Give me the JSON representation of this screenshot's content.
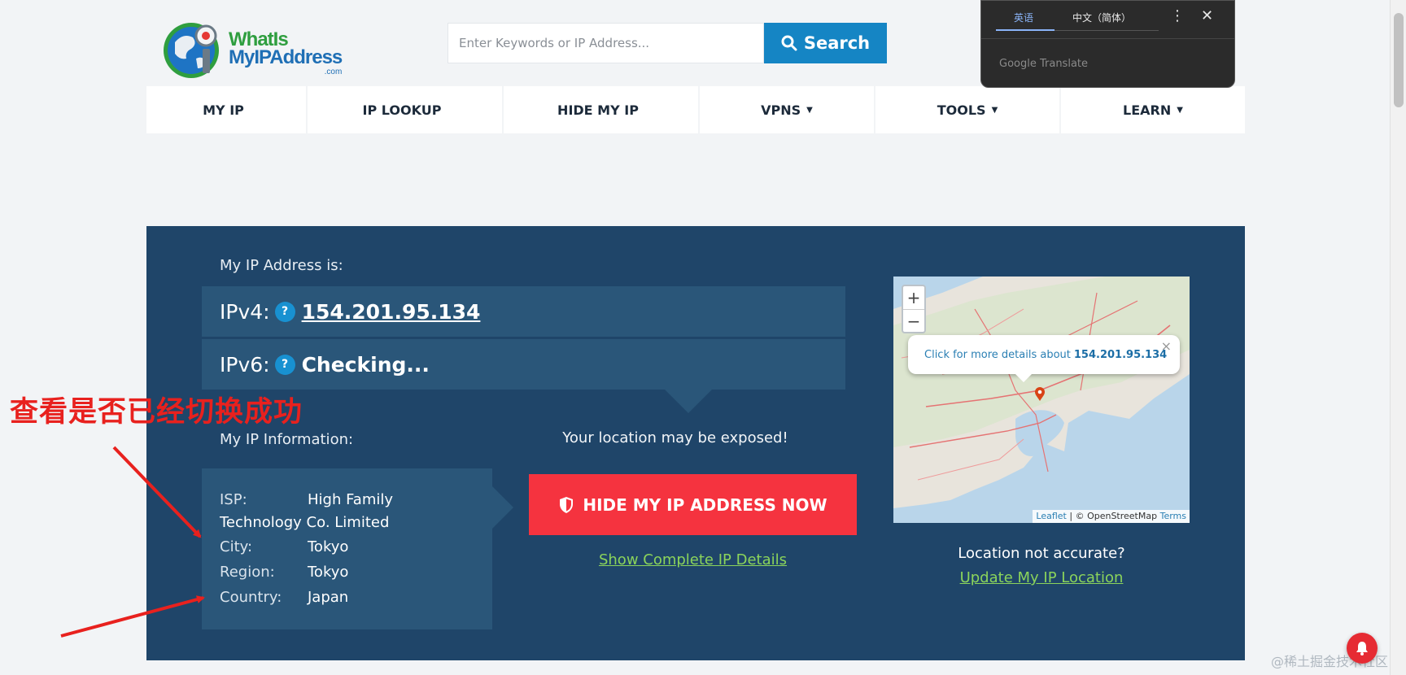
{
  "logo": {
    "line1": "WhatIs",
    "line2": "MyIPAddress",
    "tld": ".com"
  },
  "search": {
    "placeholder": "Enter Keywords or IP Address...",
    "button_label": "Search"
  },
  "nav": [
    {
      "label": "MY IP",
      "caret": ""
    },
    {
      "label": "IP LOOKUP",
      "caret": ""
    },
    {
      "label": "HIDE MY IP",
      "caret": ""
    },
    {
      "label": "VPNS",
      "caret": "▼"
    },
    {
      "label": "TOOLS",
      "caret": "▼"
    },
    {
      "label": "LEARN",
      "caret": "▼"
    }
  ],
  "ip_section": {
    "label": "My IP Address is:",
    "ipv4_label": "IPv4:",
    "ipv4_value": "154.201.95.134",
    "ipv6_label": "IPv6:",
    "ipv6_value": "Checking...",
    "help": "?"
  },
  "info_section": {
    "label": "My IP Information:",
    "isp_key": "ISP:",
    "isp_value_1": "High Family",
    "isp_value_2": "Technology Co. Limited",
    "city_key": "City:",
    "city_value": "Tokyo",
    "region_key": "Region:",
    "region_value": "Tokyo",
    "country_key": "Country:",
    "country_value": "Japan"
  },
  "hide": {
    "exposed_text": "Your location may be exposed!",
    "button_label": "HIDE MY IP ADDRESS NOW",
    "details_link": "Show Complete IP Details"
  },
  "map": {
    "zoom_in": "+",
    "zoom_out": "−",
    "popup_text": "Click for more details about",
    "popup_ip": "154.201.95.134",
    "popup_close": "×",
    "attr_leaflet": "Leaflet",
    "attr_sep": " | © OpenStreetMap ",
    "attr_terms": "Terms"
  },
  "location": {
    "question": "Location not accurate?",
    "update_link": "Update My IP Location"
  },
  "translate": {
    "tab_source": "英语",
    "tab_target": "中文（简体）",
    "menu": "⋮",
    "close": "✕",
    "brand": "Google Translate"
  },
  "annotation": {
    "text": "查看是否已经切换成功"
  },
  "watermark": "@稀土掘金技术社区",
  "colors": {
    "hero_bg": "#1f4569",
    "row_bg": "#2a5679",
    "accent_blue": "#1585c4",
    "cta_red": "#f5333f",
    "link_green": "#8bd45b",
    "annotation_red": "#e8211e"
  }
}
